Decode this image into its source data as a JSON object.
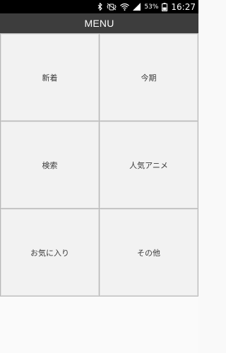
{
  "status_bar": {
    "icons": [
      "bluetooth-icon",
      "vibrate-mute-icon",
      "wifi-icon",
      "signal-icon",
      "battery-icon"
    ],
    "battery_percent": "53%",
    "time": "16:27"
  },
  "app_bar": {
    "title": "MENU"
  },
  "menu": {
    "items": [
      {
        "label": "新着"
      },
      {
        "label": "今期"
      },
      {
        "label": "検索"
      },
      {
        "label": "人気アニメ"
      },
      {
        "label": "お気に入り"
      },
      {
        "label": "その他"
      }
    ]
  }
}
